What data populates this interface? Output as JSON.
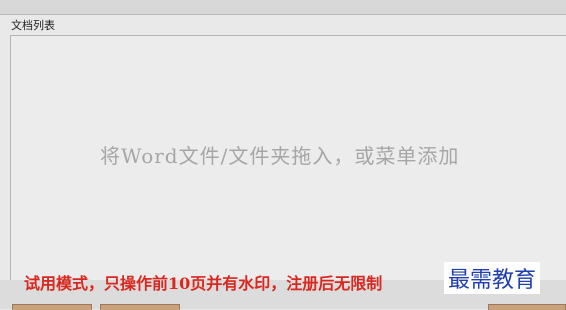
{
  "group": {
    "title": "文档列表"
  },
  "list": {
    "drop_hint": "将Word文件/文件夹拖入，或菜单添加"
  },
  "status": {
    "trial_notice": "试用模式，只操作前10页并有水印，注册后无限制"
  },
  "watermark": {
    "text": "最需教育"
  },
  "colors": {
    "notice_red": "#d8281f",
    "watermark_blue": "#1f3fae",
    "hint_gray": "#a6a6a6"
  }
}
